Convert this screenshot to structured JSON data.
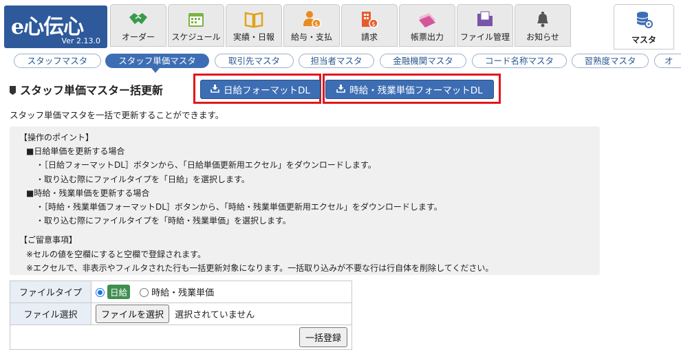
{
  "header": {
    "logo_text": "e心伝心",
    "version": "Ver 2.13.0",
    "nav": [
      {
        "label": "オーダー",
        "icon": "handshake-icon",
        "color": "#3a9a4c"
      },
      {
        "label": "スケジュール",
        "icon": "calendar-icon",
        "color": "#7cb342"
      },
      {
        "label": "実績・日報",
        "icon": "book-icon",
        "color": "#e0a31a"
      },
      {
        "label": "給与・支払",
        "icon": "person-money-icon",
        "color": "#e98b1e"
      },
      {
        "label": "請求",
        "icon": "building-money-icon",
        "color": "#e65c2e"
      },
      {
        "label": "帳票出力",
        "icon": "documents-icon",
        "color": "#d3569b"
      },
      {
        "label": "ファイル管理",
        "icon": "folder-icon",
        "color": "#7a54a8"
      },
      {
        "label": "お知らせ",
        "icon": "bell-icon",
        "color": "#555555"
      },
      {
        "label": "マスタ",
        "icon": "database-gear-icon",
        "color": "#3d6eb4"
      }
    ]
  },
  "subtabs": [
    {
      "label": "スタッフマスタ"
    },
    {
      "label": "スタッフ単価マスタ"
    },
    {
      "label": "取引先マスタ"
    },
    {
      "label": "担当者マスタ"
    },
    {
      "label": "金融機関マスタ"
    },
    {
      "label": "コード名称マスタ"
    },
    {
      "label": "習熟度マスタ"
    },
    {
      "label": "オ"
    }
  ],
  "page": {
    "title": "スタッフ単価マスター括更新",
    "buttons": {
      "daily_dl": "日給フォーマットDL",
      "hourly_dl": "時給・残業単価フォーマットDL"
    },
    "description": "スタッフ単価マスタを一括で更新することができます。"
  },
  "info": {
    "lines": [
      "【操作のポイント】",
      "■日給単価を更新する場合",
      "・［日給フォーマットDL］ボタンから、「日給単価更新用エクセル」をダウンロードします。",
      "・取り込む際にファイルタイプを「日給」を選択します。",
      "■時給・残業単価を更新する場合",
      "・［時給・残業単価フォーマットDL］ボタンから、「時給・残業単価更新用エクセル」をダウンロードします。",
      "・取り込む際にファイルタイプを「時給・残業単価」を選択します。",
      "【ご留意事項】",
      "※セルの値を空欄にすると空欄で登録されます。",
      "※エクセルで、非表示やフィルタされた行も一括更新対象になります。一括取り込みが不要な行は行自体を削除してください。"
    ]
  },
  "form": {
    "file_type_label": "ファイルタイプ",
    "option_daily": "日給",
    "option_hourly": "時給・残業単価",
    "file_select_label": "ファイル選択",
    "choose_file": "ファイルを選択",
    "no_file": "選択されていません",
    "submit": "一括登録"
  },
  "colors": {
    "accent": "#3d6eb4",
    "highlight": "#e3161b",
    "badge": "#3f8f4f"
  }
}
